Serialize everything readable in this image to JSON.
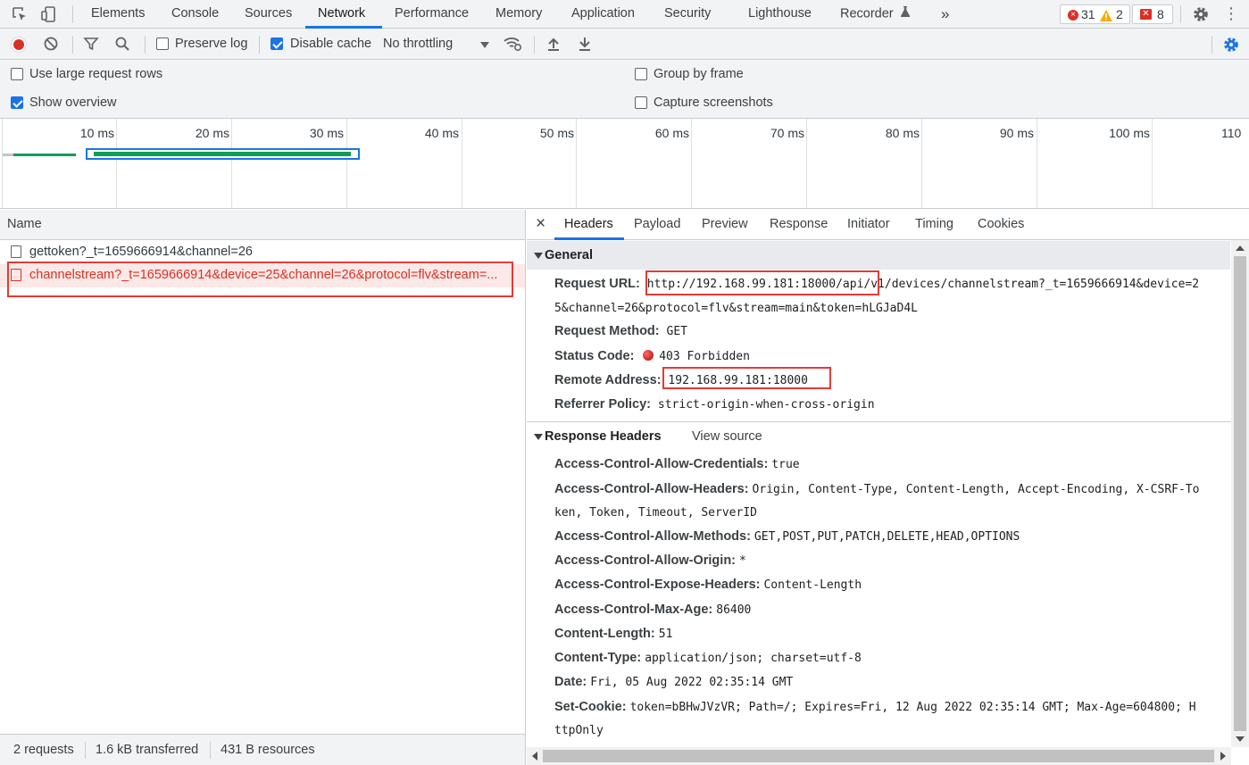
{
  "devtools": {
    "tabs": [
      "Elements",
      "Console",
      "Sources",
      "Network",
      "Performance",
      "Memory",
      "Application",
      "Security",
      "Lighthouse",
      "Recorder"
    ],
    "active_tab": "Network",
    "more_tabs_glyph": "»",
    "recorder_icon": "flask-icon",
    "errors_count": "31",
    "warnings_count": "2",
    "issues_count": "8"
  },
  "toolbar": {
    "preserve_log_label": "Preserve log",
    "preserve_log_checked": false,
    "disable_cache_label": "Disable cache",
    "disable_cache_checked": true,
    "throttling_value": "No throttling"
  },
  "settings": {
    "large_rows_label": "Use large request rows",
    "large_rows_checked": false,
    "show_overview_label": "Show overview",
    "show_overview_checked": true,
    "group_by_frame_label": "Group by frame",
    "group_by_frame_checked": false,
    "capture_screenshots_label": "Capture screenshots",
    "capture_screenshots_checked": false
  },
  "overview": {
    "ticks": [
      "10 ms",
      "20 ms",
      "30 ms",
      "40 ms",
      "50 ms",
      "60 ms",
      "70 ms",
      "80 ms",
      "90 ms",
      "100 ms",
      "110"
    ]
  },
  "requests": {
    "column_name": "Name",
    "items": [
      {
        "name": "gettoken?_t=1659666914&channel=26",
        "error": false
      },
      {
        "name": "channelstream?_t=1659666914&device=25&channel=26&protocol=flv&stream=...",
        "error": true
      }
    ],
    "summary": {
      "requests": "2 requests",
      "transferred": "1.6 kB transferred",
      "resources": "431 B resources"
    }
  },
  "detail": {
    "close_glyph": "×",
    "tabs": [
      "Headers",
      "Payload",
      "Preview",
      "Response",
      "Initiator",
      "Timing",
      "Cookies"
    ],
    "active_tab": "Headers",
    "general": {
      "title": "General",
      "request_url_key": "Request URL:",
      "request_url_line1": "http://192.168.99.181:18000/api/v1/devices/channelstream?_t=1659666914&device=2",
      "request_url_line2": "5&channel=26&protocol=flv&stream=main&token=hLGJaD4L",
      "request_method_key": "Request Method:",
      "request_method": "GET",
      "status_code_key": "Status Code:",
      "status_code": "403 Forbidden",
      "status_color": "#d93025",
      "remote_address_key": "Remote Address:",
      "remote_address": "192.168.99.181:18000",
      "referrer_policy_key": "Referrer Policy:",
      "referrer_policy": "strict-origin-when-cross-origin"
    },
    "response_headers": {
      "title": "Response Headers",
      "view_source": "View source",
      "items": [
        {
          "key": "Access-Control-Allow-Credentials:",
          "value": "true"
        },
        {
          "key": "Access-Control-Allow-Headers:",
          "value": "Origin, Content-Type, Content-Length, Accept-Encoding, X-CSRF-To",
          "value2": "ken, Token, Timeout, ServerID"
        },
        {
          "key": "Access-Control-Allow-Methods:",
          "value": "GET,POST,PUT,PATCH,DELETE,HEAD,OPTIONS"
        },
        {
          "key": "Access-Control-Allow-Origin:",
          "value": "*"
        },
        {
          "key": "Access-Control-Expose-Headers:",
          "value": "Content-Length"
        },
        {
          "key": "Access-Control-Max-Age:",
          "value": "86400"
        },
        {
          "key": "Content-Length:",
          "value": "51"
        },
        {
          "key": "Content-Type:",
          "value": "application/json; charset=utf-8"
        },
        {
          "key": "Date:",
          "value": "Fri, 05 Aug 2022 02:35:14 GMT"
        },
        {
          "key": "Set-Cookie:",
          "value": "token=bBHwJVzVR; Path=/; Expires=Fri, 12 Aug 2022 02:35:14 GMT; Max-Age=604800; H",
          "value2": "ttpOnly"
        }
      ]
    }
  },
  "colors": {
    "accent": "#1a73e8",
    "error": "#d93025",
    "highlight_box": "#e53935",
    "waterfall_green": "#0f9d58"
  }
}
